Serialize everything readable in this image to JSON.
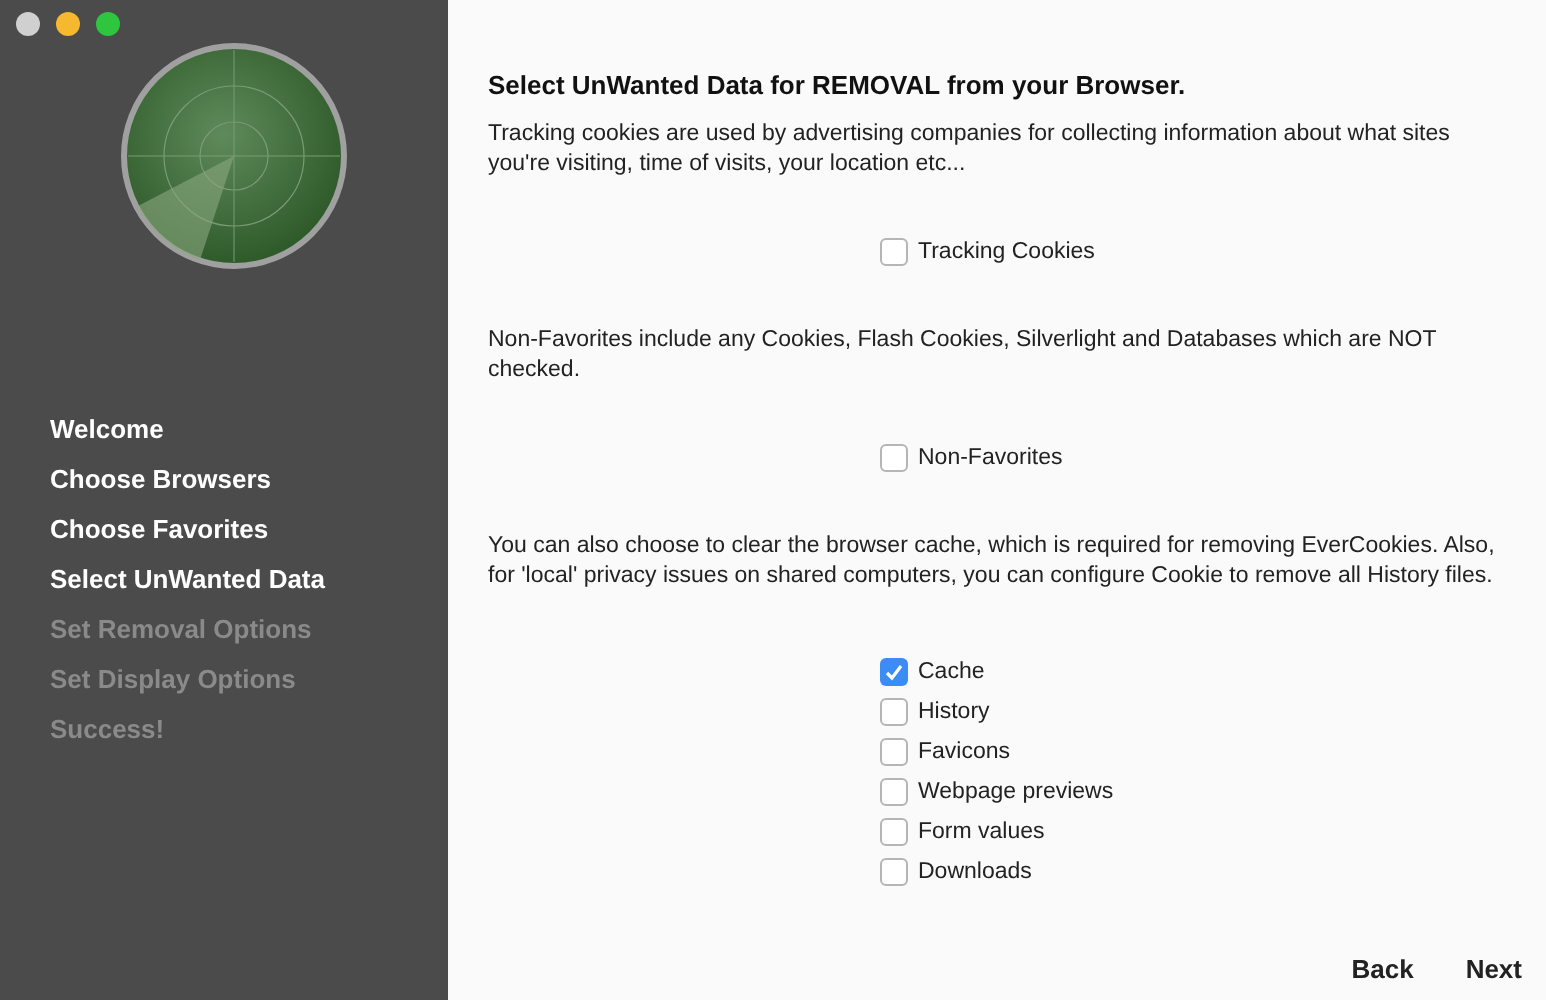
{
  "steps": [
    {
      "label": "Welcome",
      "disabled": false
    },
    {
      "label": "Choose Browsers",
      "disabled": false
    },
    {
      "label": "Choose Favorites",
      "disabled": false
    },
    {
      "label": "Select UnWanted Data",
      "disabled": false
    },
    {
      "label": "Set Removal Options",
      "disabled": true
    },
    {
      "label": "Set Display Options",
      "disabled": true
    },
    {
      "label": "Success!",
      "disabled": true
    }
  ],
  "heading": "Select UnWanted Data for REMOVAL from your Browser.",
  "sections": [
    {
      "text": "Tracking cookies are used by advertising companies for collecting information about what sites you're visiting, time of visits, your location etc...",
      "options": [
        {
          "label": "Tracking Cookies",
          "checked": false
        }
      ]
    },
    {
      "text": "Non-Favorites include any Cookies, Flash Cookies, Silverlight and Databases which are NOT checked.",
      "options": [
        {
          "label": "Non-Favorites",
          "checked": false
        }
      ]
    },
    {
      "text": "You can also choose to clear the browser cache, which is required for removing EverCookies. Also, for 'local' privacy issues on shared computers, you can configure Cookie to remove all History files.",
      "options": [
        {
          "label": "Cache",
          "checked": true
        },
        {
          "label": "History",
          "checked": false
        },
        {
          "label": "Favicons",
          "checked": false
        },
        {
          "label": "Webpage previews",
          "checked": false
        },
        {
          "label": "Form values",
          "checked": false
        },
        {
          "label": "Downloads",
          "checked": false
        }
      ]
    }
  ],
  "buttons": [
    "Back",
    "Next"
  ]
}
